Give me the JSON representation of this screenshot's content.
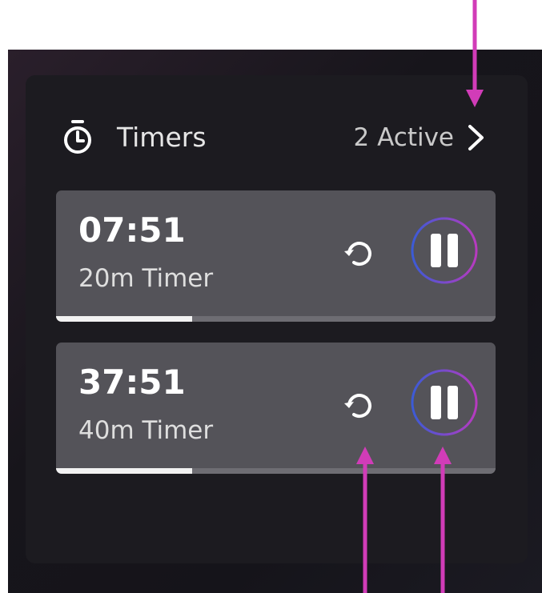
{
  "header": {
    "icon": "stopwatch-icon",
    "title": "Timers",
    "active_count": "2 Active",
    "chevron_icon": "chevron-right-icon"
  },
  "timers": [
    {
      "time": "07:51",
      "label": "20m Timer",
      "progress": 0.31,
      "reset_icon": "reset-icon",
      "pause_icon": "pause-icon"
    },
    {
      "time": "37:51",
      "label": "40m Timer",
      "progress": 0.31,
      "reset_icon": "reset-icon",
      "pause_icon": "pause-icon"
    }
  ],
  "colors": {
    "panel": "#1c1b20",
    "card": "#545359",
    "progress_fill": "#f2f2f2",
    "progress_track": "#6e6d73",
    "ring_start": "#3b5bd6",
    "ring_end": "#b83ac0",
    "annotation_arrow": "#d13cb8"
  }
}
